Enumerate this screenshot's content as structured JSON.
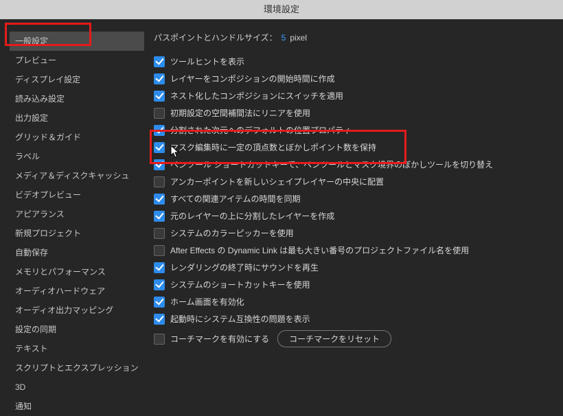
{
  "title": "環境設定",
  "sidebar": {
    "items": [
      "一般設定",
      "プレビュー",
      "ディスプレイ設定",
      "読み込み設定",
      "出力設定",
      "グリッド＆ガイド",
      "ラベル",
      "メディア＆ディスクキャッシュ",
      "ビデオプレビュー",
      "アピアランス",
      "新規プロジェクト",
      "自動保存",
      "メモリとパフォーマンス",
      "オーディオハードウェア",
      "オーディオ出力マッピング",
      "設定の同期",
      "テキスト",
      "スクリプトとエクスプレッション",
      "3D",
      "通知"
    ],
    "activeIndex": 0
  },
  "pathLabel": "パスポイントとハンドルサイズ：",
  "pathValue": "5",
  "pathUnit": "pixel",
  "options": [
    {
      "label": "ツールヒントを表示",
      "checked": true
    },
    {
      "label": "レイヤーをコンポジションの開始時間に作成",
      "checked": true
    },
    {
      "label": "ネスト化したコンポジションにスイッチを適用",
      "checked": true
    },
    {
      "label": "初期設定の空間補間法にリニアを使用",
      "checked": false
    },
    {
      "label": "分割された次元へのデフォルトの位置プロパティ",
      "checked": true
    },
    {
      "label": "マスク編集時に一定の頂点数とぼかしポイント数を保持",
      "checked": true
    },
    {
      "label": "ペンツール ショートカットキーで、ペンツールとマスク境界のぼかしツールを切り替え",
      "checked": true
    },
    {
      "label": "アンカーポイントを新しいシェイプレイヤーの中央に配置",
      "checked": false
    },
    {
      "label": "すべての関連アイテムの時間を同期",
      "checked": true
    },
    {
      "label": "元のレイヤーの上に分割したレイヤーを作成",
      "checked": true
    },
    {
      "label": "システムのカラーピッカーを使用",
      "checked": false
    },
    {
      "label": "After Effects の Dynamic Link は最も大きい番号のプロジェクトファイル名を使用",
      "checked": false
    },
    {
      "label": "レンダリングの終了時にサウンドを再生",
      "checked": true
    },
    {
      "label": "システムのショートカットキーを使用",
      "checked": true
    },
    {
      "label": "ホーム画面を有効化",
      "checked": true
    },
    {
      "label": "起動時にシステム互換性の問題を表示",
      "checked": true
    }
  ],
  "coachmark": {
    "label": "コーチマークを有効にする",
    "checked": false
  },
  "resetButton": "コーチマークをリセット",
  "colors": {
    "accent": "#2d8ceb",
    "highlight": "#e51b1b"
  }
}
